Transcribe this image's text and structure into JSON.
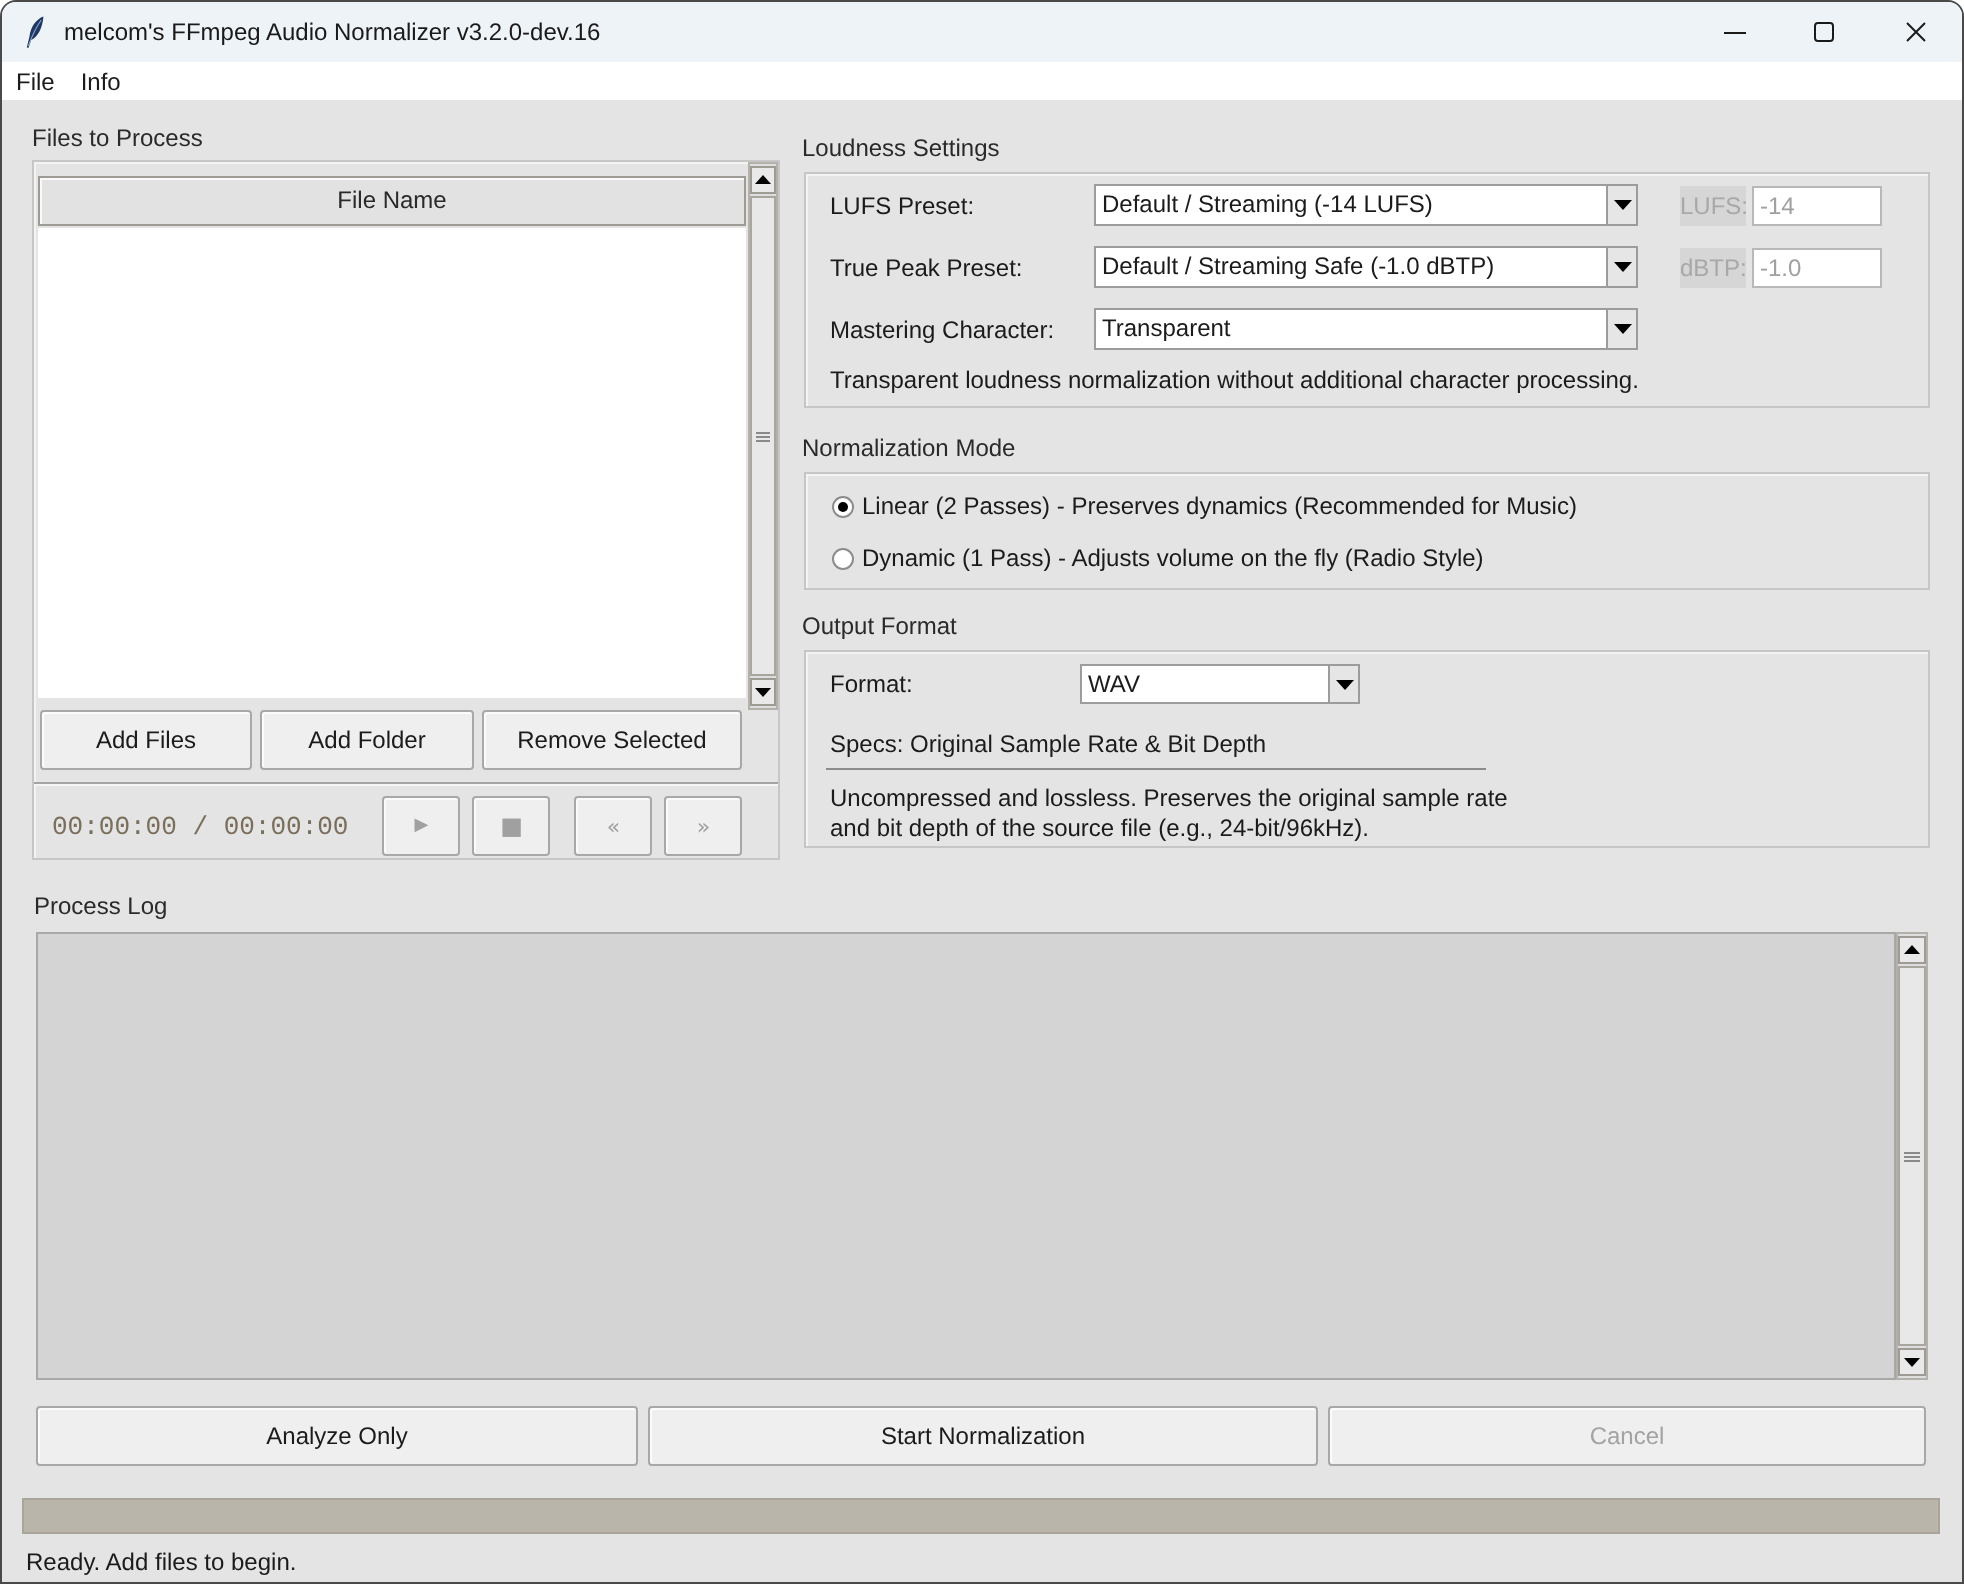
{
  "window": {
    "title": "melcom's FFmpeg Audio Normalizer v3.2.0-dev.16"
  },
  "menu": [
    {
      "label": "File"
    },
    {
      "label": "Info"
    }
  ],
  "files_panel": {
    "title": "Files to Process",
    "table": {
      "columns": [
        "File Name"
      ]
    },
    "buttons": [
      {
        "label": "Add Files"
      },
      {
        "label": "Add Folder"
      },
      {
        "label": "Remove Selected"
      }
    ],
    "player": {
      "time": "00:00:00 / 00:00:00",
      "buttons": [
        {
          "kind": "play",
          "label": "▶",
          "disabled": true
        },
        {
          "kind": "stop",
          "label": "■",
          "disabled": true
        },
        {
          "kind": "previous",
          "label": "«",
          "disabled": true
        },
        {
          "kind": "next",
          "label": "»",
          "disabled": true
        }
      ]
    }
  },
  "loudness_settings": {
    "title": "Loudness Settings",
    "presets": [
      {
        "label": "LUFS Preset:",
        "value": "Default / Streaming (-14 LUFS)",
        "custom": {
          "label": "LUFS:",
          "value": "-14",
          "disabled": true
        }
      },
      {
        "label": "True Peak Preset:",
        "value": "Default / Streaming Safe (-1.0 dBTP)",
        "custom": {
          "label": "dBTP:",
          "value": "-1.0",
          "disabled": true
        }
      },
      {
        "label": "Mastering Character:",
        "value": "Transparent"
      }
    ],
    "description": "Transparent loudness normalization without additional character processing."
  },
  "normalization_mode": {
    "title": "Normalization Mode",
    "options": [
      {
        "label": "Linear (2 Passes) - Preserves dynamics (Recommended for Music)",
        "selected": true
      },
      {
        "label": "Dynamic (1 Pass) - Adjusts volume on the fly (Radio Style)",
        "selected": false
      }
    ]
  },
  "output_format": {
    "title": "Output Format",
    "format": {
      "label": "Format:",
      "value": "WAV"
    },
    "specs": "Specs: Original Sample Rate & Bit Depth",
    "description": "Uncompressed and lossless. Preserves the original sample rate and bit depth of the source file (e.g., 24-bit/96kHz)."
  },
  "process_log": {
    "title": "Process Log"
  },
  "actions": [
    {
      "label": "Analyze Only",
      "disabled": false
    },
    {
      "label": "Start Normalization",
      "disabled": false
    },
    {
      "label": "Cancel",
      "disabled": true
    }
  ],
  "progress": {
    "level": 0
  },
  "status_bar": {
    "text": "Ready. Add files to begin."
  }
}
